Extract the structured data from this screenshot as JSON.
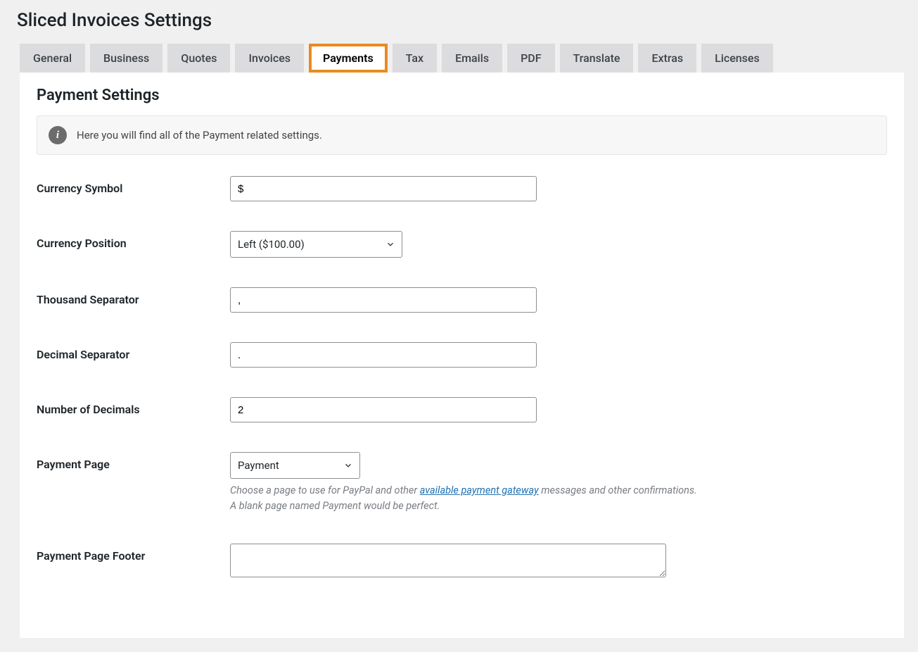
{
  "page_title": "Sliced Invoices Settings",
  "tabs": [
    {
      "label": "General"
    },
    {
      "label": "Business"
    },
    {
      "label": "Quotes"
    },
    {
      "label": "Invoices"
    },
    {
      "label": "Payments"
    },
    {
      "label": "Tax"
    },
    {
      "label": "Emails"
    },
    {
      "label": "PDF"
    },
    {
      "label": "Translate"
    },
    {
      "label": "Extras"
    },
    {
      "label": "Licenses"
    }
  ],
  "section_title": "Payment Settings",
  "info_banner": "Here you will find all of the Payment related settings.",
  "fields": {
    "currency_symbol": {
      "label": "Currency Symbol",
      "value": "$"
    },
    "currency_position": {
      "label": "Currency Position",
      "value": "Left ($100.00)"
    },
    "thousand_separator": {
      "label": "Thousand Separator",
      "value": ","
    },
    "decimal_separator": {
      "label": "Decimal Separator",
      "value": "."
    },
    "number_of_decimals": {
      "label": "Number of Decimals",
      "value": "2"
    },
    "payment_page": {
      "label": "Payment Page",
      "value": "Payment",
      "help_pre": "Choose a page to use for PayPal and other ",
      "help_link": "available payment gateway",
      "help_post": " messages and other confirmations.",
      "help_line2": "A blank page named Payment would be perfect."
    },
    "payment_page_footer": {
      "label": "Payment Page Footer",
      "value": ""
    }
  }
}
